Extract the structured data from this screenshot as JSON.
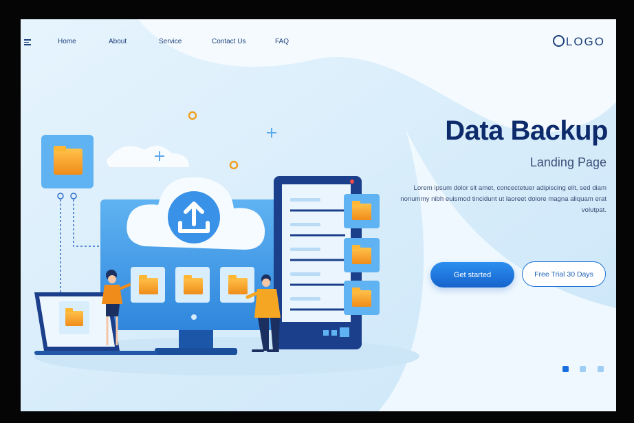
{
  "nav": {
    "items": [
      {
        "label": "Home"
      },
      {
        "label": "About"
      },
      {
        "label": "Service"
      },
      {
        "label": "Contact Us"
      },
      {
        "label": "FAQ"
      }
    ],
    "logo": "LOGO"
  },
  "hero": {
    "title": "Data Backup",
    "subtitle": "Landing Page",
    "description": "Lorem ipsum dolor sit amet, concectetuer adipiscing elit, sed diam nonummy nibh euismod tincidunt ut laoreet dolore magna aliquam erat volutpat.",
    "primary_button": "Get started",
    "secondary_button": "Free Trial 30 Days"
  },
  "pagination": {
    "total": 3,
    "active_index": 0
  },
  "colors": {
    "accent": "#1a6fe0",
    "title": "#0d2a6b",
    "folder": "#f5a623",
    "background": "#dff0fb"
  },
  "icons": [
    "menu-icon",
    "cloud-upload-icon",
    "folder-icon",
    "server-icon",
    "laptop-icon",
    "monitor-icon"
  ]
}
